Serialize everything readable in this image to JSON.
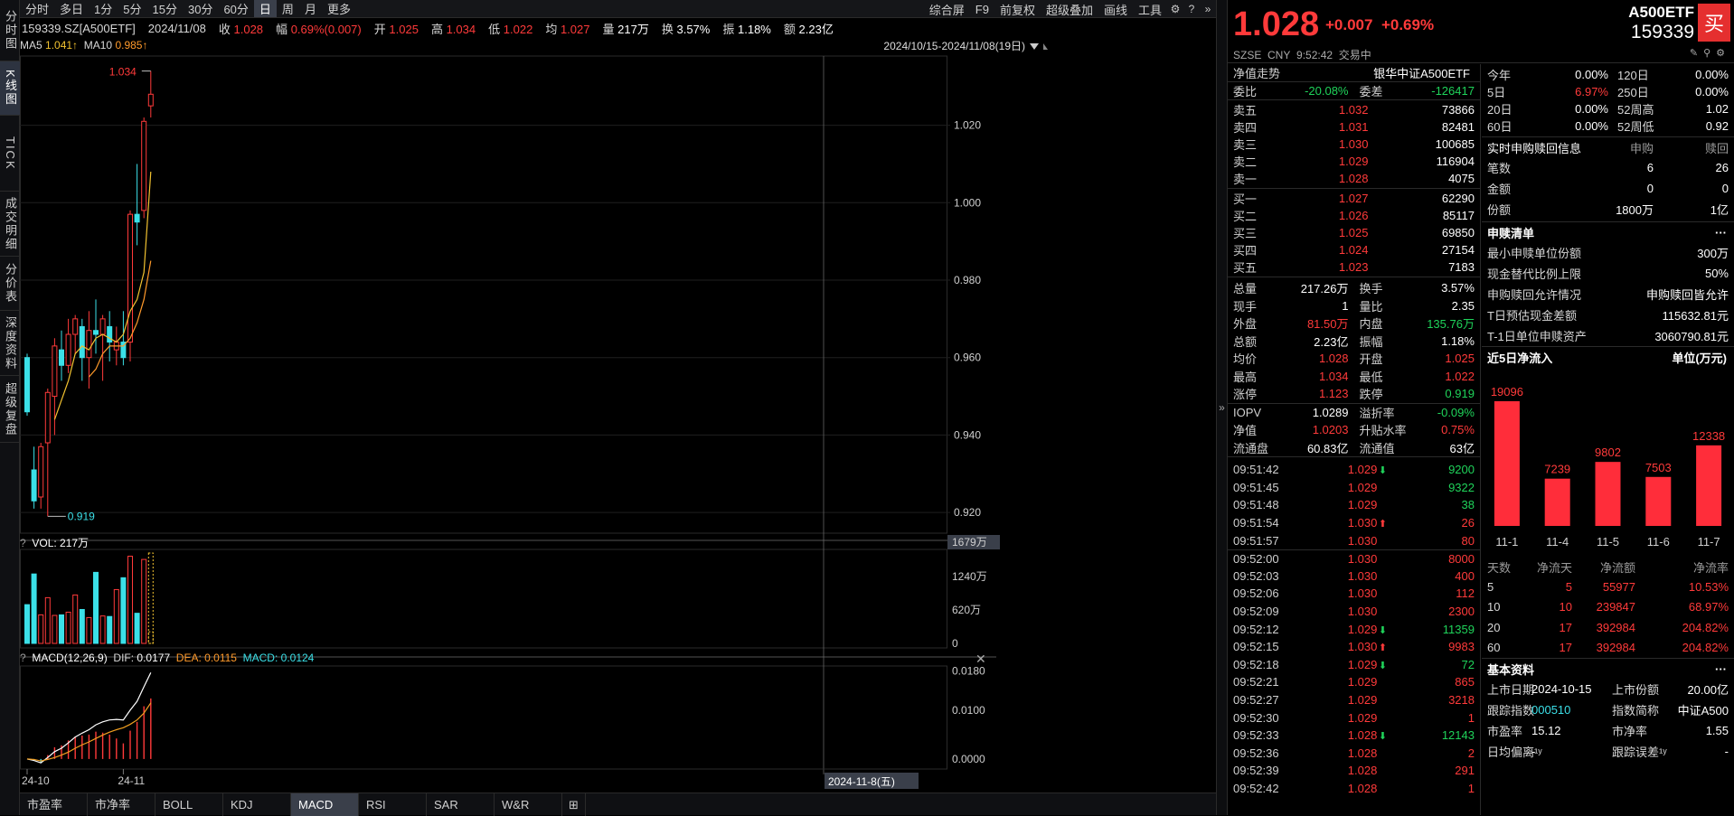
{
  "leftbar": [
    "分时图",
    "K线图",
    "TICK",
    "成交明细",
    "分价表",
    "深度资料",
    "超级复盘"
  ],
  "topbar": {
    "periods": [
      "分时",
      "多日",
      "1分",
      "5分",
      "15分",
      "30分",
      "60分",
      "日",
      "周",
      "月",
      "更多"
    ],
    "active_period": "日",
    "right_items": [
      "综合屏",
      "F9",
      "前复权",
      "超级叠加",
      "画线",
      "工具"
    ],
    "icons": [
      "gear-icon",
      "help-icon",
      "double-chevron-right-icon"
    ]
  },
  "infobar": {
    "code": "159339.SZ[A500ETF]",
    "date": "2024/11/08",
    "close_label": "收",
    "close": "1.028",
    "amp_label": "幅",
    "amp": "0.69%(0.007)",
    "open_label": "开",
    "open": "1.025",
    "high_label": "高",
    "high": "1.034",
    "low_label": "低",
    "low": "1.022",
    "avg_label": "均",
    "avg": "1.027",
    "vol_label": "量",
    "vol": "217万",
    "turn_label": "换",
    "turn": "3.57%",
    "swing_label": "振",
    "swing": "1.18%",
    "amt_label": "额",
    "amt": "2.23亿"
  },
  "mabar": {
    "ma5_label": "MA5",
    "ma5": "1.041↑",
    "ma10_label": "MA10",
    "ma10": "0.985↑"
  },
  "range_text": "2024/10/15-2024/11/08(19日)",
  "price_axis": [
    "1.020",
    "1.000",
    "0.980",
    "0.960",
    "0.940",
    "0.920"
  ],
  "high_mark": "1.034",
  "low_mark": "0.919",
  "vol_header": {
    "q": "?",
    "text": "VOL: 217万"
  },
  "vol_axis": [
    "1679万",
    "1240万",
    "620万",
    "0"
  ],
  "macd_header": {
    "q": "?",
    "name": "MACD(12,26,9)",
    "dif_label": "DIF:",
    "dif": "0.0177",
    "dea_label": "DEA:",
    "dea": "0.0115",
    "macd_label": "MACD:",
    "macd": "0.0124"
  },
  "macd_axis": [
    "0.0180",
    "0.0100",
    "0.0000"
  ],
  "date_axis": [
    "24-10",
    "24-11"
  ],
  "crosshair_date": "2024-11-8(五)",
  "bottom_tabs": [
    "市盈率",
    "市净率",
    "BOLL",
    "KDJ",
    "MACD",
    "RSI",
    "SAR",
    "W&R"
  ],
  "active_bottom_tab": "MACD",
  "quote": {
    "price": "1.028",
    "change": "+0.007",
    "pct": "+0.69%",
    "exchange": "SZSE",
    "currency": "CNY",
    "time": "9:52:42",
    "status": "交易中",
    "name": "A500ETF",
    "code": "159339",
    "buy": "买"
  },
  "nav_trend": {
    "label": "净值走势",
    "name": "银华中证A500ETF"
  },
  "weibi": {
    "label": "委比",
    "value": "-20.08%",
    "label2": "委差",
    "value2": "-126417"
  },
  "asks": [
    {
      "label": "卖五",
      "price": "1.032",
      "vol": "73866"
    },
    {
      "label": "卖四",
      "price": "1.031",
      "vol": "82481"
    },
    {
      "label": "卖三",
      "price": "1.030",
      "vol": "100685"
    },
    {
      "label": "卖二",
      "price": "1.029",
      "vol": "116904"
    },
    {
      "label": "卖一",
      "price": "1.028",
      "vol": "4075"
    }
  ],
  "bids": [
    {
      "label": "买一",
      "price": "1.027",
      "vol": "62290"
    },
    {
      "label": "买二",
      "price": "1.026",
      "vol": "85117"
    },
    {
      "label": "买三",
      "price": "1.025",
      "vol": "69850"
    },
    {
      "label": "买四",
      "price": "1.024",
      "vol": "27154"
    },
    {
      "label": "买五",
      "price": "1.023",
      "vol": "7183"
    }
  ],
  "stats": [
    {
      "l1": "总量",
      "v1": "217.26万",
      "c1": "white",
      "l2": "换手",
      "v2": "3.57%",
      "c2": "white"
    },
    {
      "l1": "现手",
      "v1": "1",
      "c1": "white",
      "l2": "量比",
      "v2": "2.35",
      "c2": "white"
    },
    {
      "l1": "外盘",
      "v1": "81.50万",
      "c1": "red",
      "l2": "内盘",
      "v2": "135.76万",
      "c2": "green"
    },
    {
      "l1": "总额",
      "v1": "2.23亿",
      "c1": "white",
      "l2": "振幅",
      "v2": "1.18%",
      "c2": "white"
    },
    {
      "l1": "均价",
      "v1": "1.028",
      "c1": "red",
      "l2": "开盘",
      "v2": "1.025",
      "c2": "red"
    },
    {
      "l1": "最高",
      "v1": "1.034",
      "c1": "red",
      "l2": "最低",
      "v2": "1.022",
      "c2": "red"
    },
    {
      "l1": "涨停",
      "v1": "1.123",
      "c1": "red",
      "l2": "跌停",
      "v2": "0.919",
      "c2": "green"
    }
  ],
  "iopv": [
    {
      "l1": "IOPV",
      "v1": "1.0289",
      "c1": "white",
      "l2": "溢折率",
      "v2": "-0.09%",
      "c2": "green"
    },
    {
      "l1": "净值",
      "v1": "1.0203",
      "c1": "red",
      "l2": "升贴水率",
      "v2": "0.75%",
      "c2": "red"
    },
    {
      "l1": "流通盘",
      "v1": "60.83亿",
      "c1": "white",
      "l2": "流通值",
      "v2": "63亿",
      "c2": "white"
    }
  ],
  "ticks": [
    {
      "t": "09:51:42",
      "p": "1.029",
      "d": "down",
      "v": "9200",
      "c": "green"
    },
    {
      "t": "09:51:45",
      "p": "1.029",
      "d": "",
      "v": "9322",
      "c": "green"
    },
    {
      "t": "09:51:48",
      "p": "1.029",
      "d": "",
      "v": "38",
      "c": "green"
    },
    {
      "t": "09:51:54",
      "p": "1.030",
      "d": "up",
      "v": "26",
      "c": "red"
    },
    {
      "t": "09:51:57",
      "p": "1.030",
      "d": "",
      "v": "80",
      "c": "red"
    },
    {
      "t": "09:52:00",
      "p": "1.030",
      "d": "",
      "v": "8000",
      "c": "red"
    },
    {
      "t": "09:52:03",
      "p": "1.030",
      "d": "",
      "v": "400",
      "c": "red"
    },
    {
      "t": "09:52:06",
      "p": "1.030",
      "d": "",
      "v": "112",
      "c": "red"
    },
    {
      "t": "09:52:09",
      "p": "1.030",
      "d": "",
      "v": "2300",
      "c": "red"
    },
    {
      "t": "09:52:12",
      "p": "1.029",
      "d": "down",
      "v": "11359",
      "c": "green"
    },
    {
      "t": "09:52:15",
      "p": "1.030",
      "d": "up",
      "v": "9983",
      "c": "red"
    },
    {
      "t": "09:52:18",
      "p": "1.029",
      "d": "down",
      "v": "72",
      "c": "green"
    },
    {
      "t": "09:52:21",
      "p": "1.029",
      "d": "",
      "v": "865",
      "c": "red"
    },
    {
      "t": "09:52:27",
      "p": "1.029",
      "d": "",
      "v": "3218",
      "c": "red"
    },
    {
      "t": "09:52:30",
      "p": "1.029",
      "d": "",
      "v": "1",
      "c": "red"
    },
    {
      "t": "09:52:33",
      "p": "1.028",
      "d": "down",
      "v": "12143",
      "c": "green"
    },
    {
      "t": "09:52:36",
      "p": "1.028",
      "d": "",
      "v": "2",
      "c": "red"
    },
    {
      "t": "09:52:39",
      "p": "1.028",
      "d": "",
      "v": "291",
      "c": "red"
    },
    {
      "t": "09:52:42",
      "p": "1.028",
      "d": "",
      "v": "1",
      "c": "red"
    }
  ],
  "perf": [
    {
      "l1": "今年",
      "v1": "0.00%",
      "c1": "white",
      "l2": "120日",
      "v2": "0.00%"
    },
    {
      "l1": "5日",
      "v1": "6.97%",
      "c1": "red",
      "l2": "250日",
      "v2": "0.00%"
    },
    {
      "l1": "20日",
      "v1": "0.00%",
      "c1": "white",
      "l2": "52周高",
      "v2": "1.02"
    },
    {
      "l1": "60日",
      "v1": "0.00%",
      "c1": "white",
      "l2": "52周低",
      "v2": "0.92"
    }
  ],
  "subscribe": {
    "title": "实时申购赎回信息",
    "h1": "申购",
    "h2": "赎回",
    "rows": [
      {
        "l": "笔数",
        "a": "6",
        "b": "26"
      },
      {
        "l": "金额",
        "a": "0",
        "b": "0"
      },
      {
        "l": "份额",
        "a": "1800万",
        "b": "1亿"
      }
    ]
  },
  "creation": {
    "title": "申赎清单",
    "more": "···",
    "rows": [
      {
        "l": "最小申赎单位份额",
        "v": "300万"
      },
      {
        "l": "现金替代比例上限",
        "v": "50%"
      },
      {
        "l": "申购赎回允许情况",
        "v": "申购赎回皆允许"
      },
      {
        "l": "T日预估现金差额",
        "v": "115632.81元"
      },
      {
        "l": "T-1日单位申赎资产",
        "v": "3060790.81元"
      }
    ]
  },
  "netflow": {
    "title": "近5日净流入",
    "unit": "单位(万元)",
    "table_header": [
      "天数",
      "净流天",
      "净流额",
      "净流率"
    ],
    "table": [
      {
        "d": "5",
        "n": "5",
        "a": "55977",
        "r": "10.53%"
      },
      {
        "d": "10",
        "n": "10",
        "a": "239847",
        "r": "68.97%"
      },
      {
        "d": "20",
        "n": "17",
        "a": "392984",
        "r": "204.82%"
      },
      {
        "d": "60",
        "n": "17",
        "a": "392984",
        "r": "204.82%"
      }
    ]
  },
  "basic": {
    "title": "基本资料",
    "more": "···",
    "rows": [
      {
        "l1": "上市日期",
        "v1": "2024-10-15",
        "c1": "white",
        "l2": "上市份额",
        "v2": "20.00亿",
        "c2": "white"
      },
      {
        "l1": "跟踪指数",
        "v1": "000510",
        "c1": "cyan",
        "l2": "指数简称",
        "v2": "中证A500",
        "c2": "white"
      },
      {
        "l1": "市盈率",
        "v1": "15.12",
        "c1": "white",
        "l2": "市净率",
        "v2": "1.55",
        "c2": "white"
      },
      {
        "l1": "日均偏离¹ʸ",
        "v1": "-",
        "c1": "white",
        "l2": "跟踪误差¹ʸ",
        "v2": "-",
        "c2": "white"
      }
    ]
  },
  "chart_data": [
    {
      "type": "candlestick",
      "title": "159339.SZ[A500ETF]",
      "ylim": [
        0.917,
        1.036
      ],
      "candles": [
        {
          "o": 0.96,
          "h": 0.961,
          "l": 0.945,
          "c": 0.946
        },
        {
          "o": 0.931,
          "h": 0.937,
          "l": 0.921,
          "c": 0.923
        },
        {
          "o": 0.924,
          "h": 0.938,
          "l": 0.921,
          "c": 0.937
        },
        {
          "o": 0.938,
          "h": 0.952,
          "l": 0.919,
          "c": 0.951
        },
        {
          "o": 0.95,
          "h": 0.965,
          "l": 0.94,
          "c": 0.963
        },
        {
          "o": 0.962,
          "h": 0.967,
          "l": 0.954,
          "c": 0.958
        },
        {
          "o": 0.958,
          "h": 0.97,
          "l": 0.956,
          "c": 0.966
        },
        {
          "o": 0.966,
          "h": 0.971,
          "l": 0.961,
          "c": 0.97
        },
        {
          "o": 0.968,
          "h": 0.97,
          "l": 0.954,
          "c": 0.96
        },
        {
          "o": 0.96,
          "h": 0.972,
          "l": 0.952,
          "c": 0.967
        },
        {
          "o": 0.967,
          "h": 0.975,
          "l": 0.961,
          "c": 0.966
        },
        {
          "o": 0.966,
          "h": 0.971,
          "l": 0.954,
          "c": 0.97
        },
        {
          "o": 0.968,
          "h": 0.972,
          "l": 0.959,
          "c": 0.964
        },
        {
          "o": 0.962,
          "h": 0.968,
          "l": 0.958,
          "c": 0.964
        },
        {
          "o": 0.964,
          "h": 0.972,
          "l": 0.958,
          "c": 0.96
        },
        {
          "o": 0.964,
          "h": 0.998,
          "l": 0.959,
          "c": 0.997
        },
        {
          "o": 0.997,
          "h": 1.01,
          "l": 0.989,
          "c": 0.995
        },
        {
          "o": 0.998,
          "h": 1.022,
          "l": 0.996,
          "c": 1.021
        },
        {
          "o": 1.025,
          "h": 1.034,
          "l": 1.022,
          "c": 1.028
        }
      ],
      "ma5": [
        null,
        null,
        null,
        null,
        0.944,
        0.949,
        0.954,
        0.961,
        0.963,
        0.962,
        0.965,
        0.966,
        0.965,
        0.964,
        0.966,
        0.972,
        0.975,
        0.982,
        1.008
      ],
      "ma10": [
        null,
        null,
        null,
        null,
        null,
        null,
        null,
        null,
        null,
        0.955,
        0.957,
        0.961,
        0.963,
        0.963,
        0.963,
        0.965,
        0.969,
        0.975,
        0.985
      ]
    },
    {
      "type": "bar",
      "ylabel": "VOL",
      "ylim": [
        0,
        1679
      ],
      "values": [
        720,
        1290,
        530,
        850,
        520,
        530,
        580,
        900,
        630,
        480,
        1320,
        510,
        500,
        1000,
        1220,
        1620,
        560,
        1560,
        217
      ]
    },
    {
      "type": "line",
      "ylim": [
        -0.0015,
        0.0185
      ],
      "dif": [
        0.0,
        -0.0003,
        -0.0008,
        0.0003,
        0.0015,
        0.0022,
        0.0033,
        0.0045,
        0.0053,
        0.006,
        0.007,
        0.0076,
        0.008,
        0.0081,
        0.008,
        0.01,
        0.0118,
        0.0148,
        0.0177
      ],
      "dea": [
        0.0,
        -0.0001,
        -0.0004,
        -0.0001,
        0.0003,
        0.0008,
        0.0014,
        0.0022,
        0.0029,
        0.0035,
        0.0042,
        0.0049,
        0.0055,
        0.006,
        0.0064,
        0.0071,
        0.008,
        0.0094,
        0.0115
      ],
      "macd_bar": [
        0.0,
        -0.0004,
        -0.0008,
        0.0008,
        0.0024,
        0.0028,
        0.0038,
        0.0046,
        0.0048,
        0.005,
        0.0056,
        0.0054,
        0.005,
        0.0042,
        0.0032,
        0.0058,
        0.0076,
        0.0108,
        0.0124
      ]
    },
    {
      "type": "bar",
      "title": "近5日净流入",
      "categories": [
        "11-1",
        "11-4",
        "11-5",
        "11-6",
        "11-7"
      ],
      "values": [
        19096,
        7239,
        9802,
        7503,
        12338
      ]
    }
  ],
  "colors": {
    "up": "#ff3a3a",
    "down": "#3be0e8",
    "ma5": "#f2c230",
    "ma10": "#ff9a2b",
    "dif": "#ffffff",
    "dea": "#f2a020"
  }
}
